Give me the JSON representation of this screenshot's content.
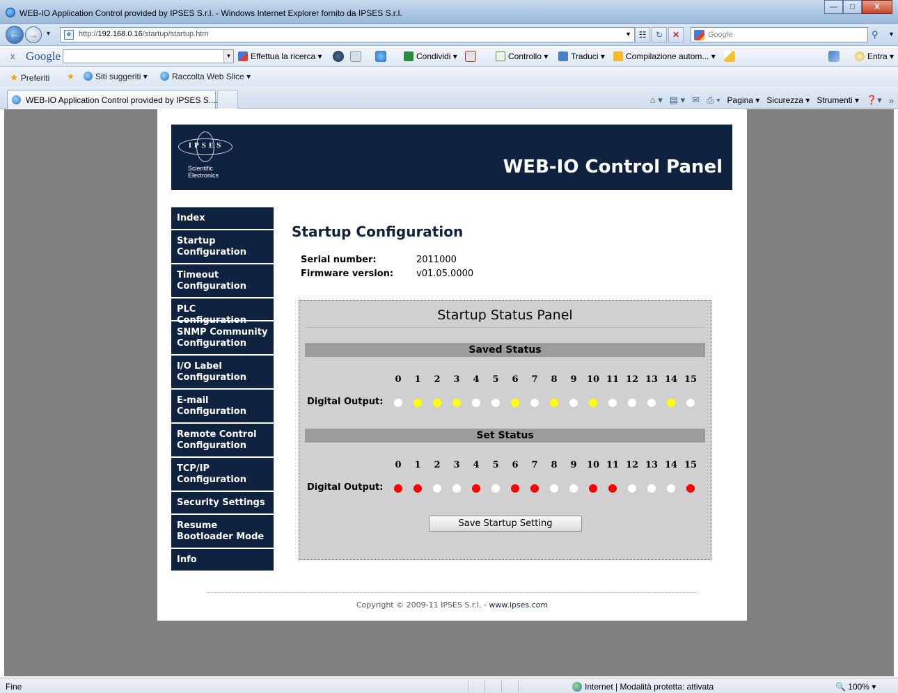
{
  "browser": {
    "window_title": "WEB-IO Application Control provided by IPSES S.r.l. - Windows Internet Explorer fornito da IPSES S.r.l.",
    "url_prefix": "http://",
    "url_host": "192.168.0.16",
    "url_path": "/startup/startup.htm",
    "search_placeholder": "Google",
    "google_logo": "Google",
    "google_toolbar": {
      "search_label": "Effettua la ricerca",
      "share_label": "Condividi",
      "check_label": "Controllo",
      "translate_label": "Traduci",
      "autofill_label": "Compilazione autom...",
      "signin_label": "Entra"
    },
    "favorites": {
      "favorites_label": "Preferiti",
      "suggested_label": "Siti suggeriti",
      "webslice_label": "Raccolta Web Slice"
    },
    "tab_title": "WEB-IO Application Control provided by IPSES S....",
    "command_bar": {
      "page_label": "Pagina",
      "security_label": "Sicurezza",
      "tools_label": "Strumenti"
    },
    "status": {
      "text": "Fine",
      "zone": "Internet | Modalità protetta: attivata",
      "zoom": "100%"
    }
  },
  "site": {
    "logo_letters": "IPSES",
    "logo_subtitle_1": "Scientific",
    "logo_subtitle_2": "Electronics",
    "header_title": "WEB-IO Control Panel",
    "nav": [
      {
        "label": "Index"
      },
      {
        "label": "Startup Configuration"
      },
      {
        "label": "Timeout Configuration"
      },
      {
        "label": "PLC Configuration"
      },
      {
        "label": "SNMP Community Configuration"
      },
      {
        "label": "I/O Label Configuration"
      },
      {
        "label": "E-mail Configuration"
      },
      {
        "label": "Remote Control Configuration"
      },
      {
        "label": "TCP/IP Configuration"
      },
      {
        "label": "Security Settings"
      },
      {
        "label": "Resume Bootloader Mode"
      },
      {
        "label": "Info"
      }
    ],
    "copyright_prefix": "Copyright © 2009-11 IPSES S.r.l. - ",
    "copyright_link": "www.ipses.com"
  },
  "main": {
    "title": "Startup Configuration",
    "serial_label": "Serial number:",
    "serial_value": "2011000",
    "firmware_label": "Firmware version:",
    "firmware_value": "v01.05.0000",
    "panel_title": "Startup Status Panel",
    "saved_status_title": "Saved Status",
    "set_status_title": "Set Status",
    "digital_output_label": "Digital Output:",
    "channels": [
      "0",
      "1",
      "2",
      "3",
      "4",
      "5",
      "6",
      "7",
      "8",
      "9",
      "10",
      "11",
      "12",
      "13",
      "14",
      "15"
    ],
    "saved_outputs": [
      false,
      true,
      true,
      true,
      false,
      false,
      true,
      false,
      true,
      false,
      true,
      false,
      false,
      false,
      true,
      false
    ],
    "set_outputs": [
      true,
      true,
      false,
      false,
      true,
      false,
      true,
      true,
      false,
      false,
      true,
      true,
      false,
      false,
      false,
      true
    ],
    "save_button": "Save Startup Setting",
    "colors": {
      "saved_on": "#ffff00",
      "set_on": "#ff0000",
      "off": "#ffffff"
    }
  }
}
